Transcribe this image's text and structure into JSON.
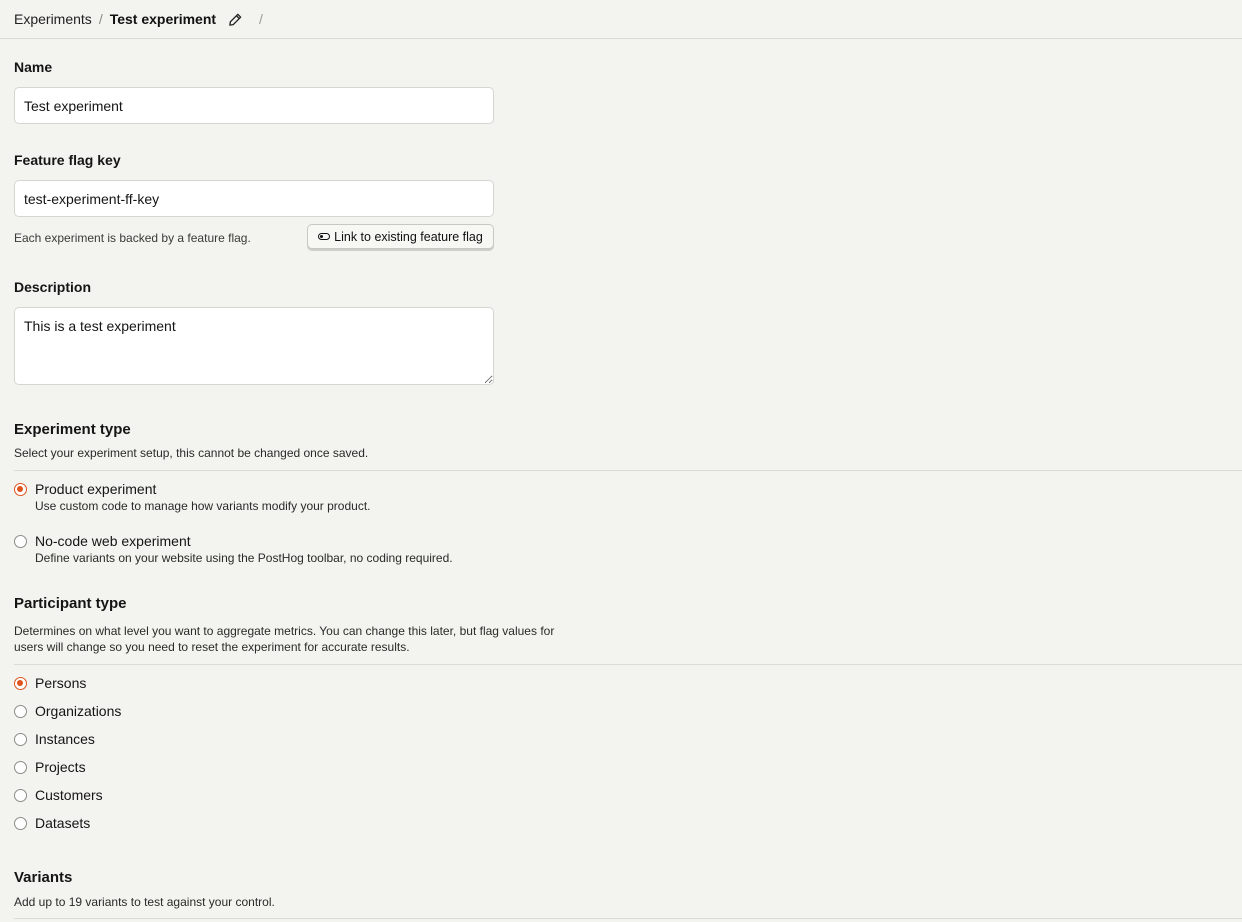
{
  "breadcrumb": {
    "parent": "Experiments",
    "separator": "/",
    "current": "Test experiment",
    "trailing_separator": "/"
  },
  "form": {
    "name": {
      "label": "Name",
      "value": "Test experiment"
    },
    "feature_flag_key": {
      "label": "Feature flag key",
      "value": "test-experiment-ff-key",
      "hint": "Each experiment is backed by a feature flag.",
      "link_button": "Link to existing feature flag"
    },
    "description": {
      "label": "Description",
      "value": "This is a test experiment"
    }
  },
  "experiment_type": {
    "title": "Experiment type",
    "description": "Select your experiment setup, this cannot be changed once saved.",
    "options": [
      {
        "label": "Product experiment",
        "sub": "Use custom code to manage how variants modify your product.",
        "checked": true
      },
      {
        "label": "No-code web experiment",
        "sub": "Define variants on your website using the PostHog toolbar, no coding required.",
        "checked": false
      }
    ]
  },
  "participant_type": {
    "title": "Participant type",
    "description_line1": "Determines on what level you want to aggregate metrics. You can change this later, but flag values for",
    "description_line2": "users will change so you need to reset the experiment for accurate results.",
    "options": [
      {
        "label": "Persons",
        "checked": true
      },
      {
        "label": "Organizations",
        "checked": false
      },
      {
        "label": "Instances",
        "checked": false
      },
      {
        "label": "Projects",
        "checked": false
      },
      {
        "label": "Customers",
        "checked": false
      },
      {
        "label": "Datasets",
        "checked": false
      }
    ]
  },
  "variants": {
    "title": "Variants",
    "description": "Add up to 19 variants to test against your control."
  },
  "colors": {
    "accent": "#e0531f",
    "background": "#f3f3ef"
  },
  "icons": {
    "edit": "pencil-icon",
    "link": "toggle-icon"
  }
}
